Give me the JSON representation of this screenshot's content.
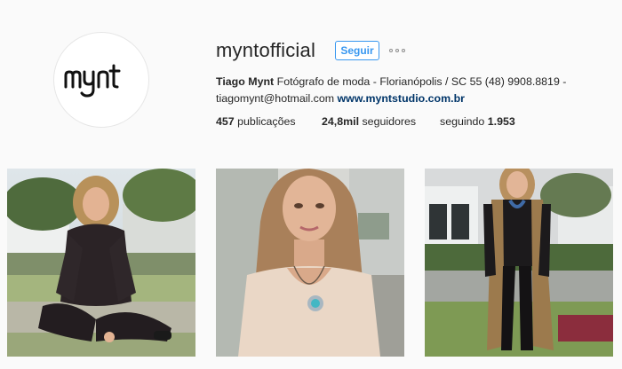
{
  "profile": {
    "username": "myntofficial",
    "follow_label": "Seguir",
    "avatar_logo_text": "mynt",
    "full_name": "Tiago Mynt",
    "bio_text": "Fotógrafo de moda - Florianópolis / SC 55 (48) 9908.8819 - tiagomynt@hotmail.com",
    "website": "www.myntstudio.com.br"
  },
  "stats": {
    "posts_count": "457",
    "posts_label": "publicações",
    "followers_count": "24,8mil",
    "followers_label": "seguidores",
    "following_label": "seguindo",
    "following_count": "1.953"
  },
  "icons": {
    "more": "more-options-icon"
  },
  "colors": {
    "accent": "#3897f0",
    "link": "#003569",
    "background": "#fafafa",
    "text": "#262626"
  },
  "photos": [
    {
      "name": "post-photo-1"
    },
    {
      "name": "post-photo-2"
    },
    {
      "name": "post-photo-3"
    }
  ]
}
